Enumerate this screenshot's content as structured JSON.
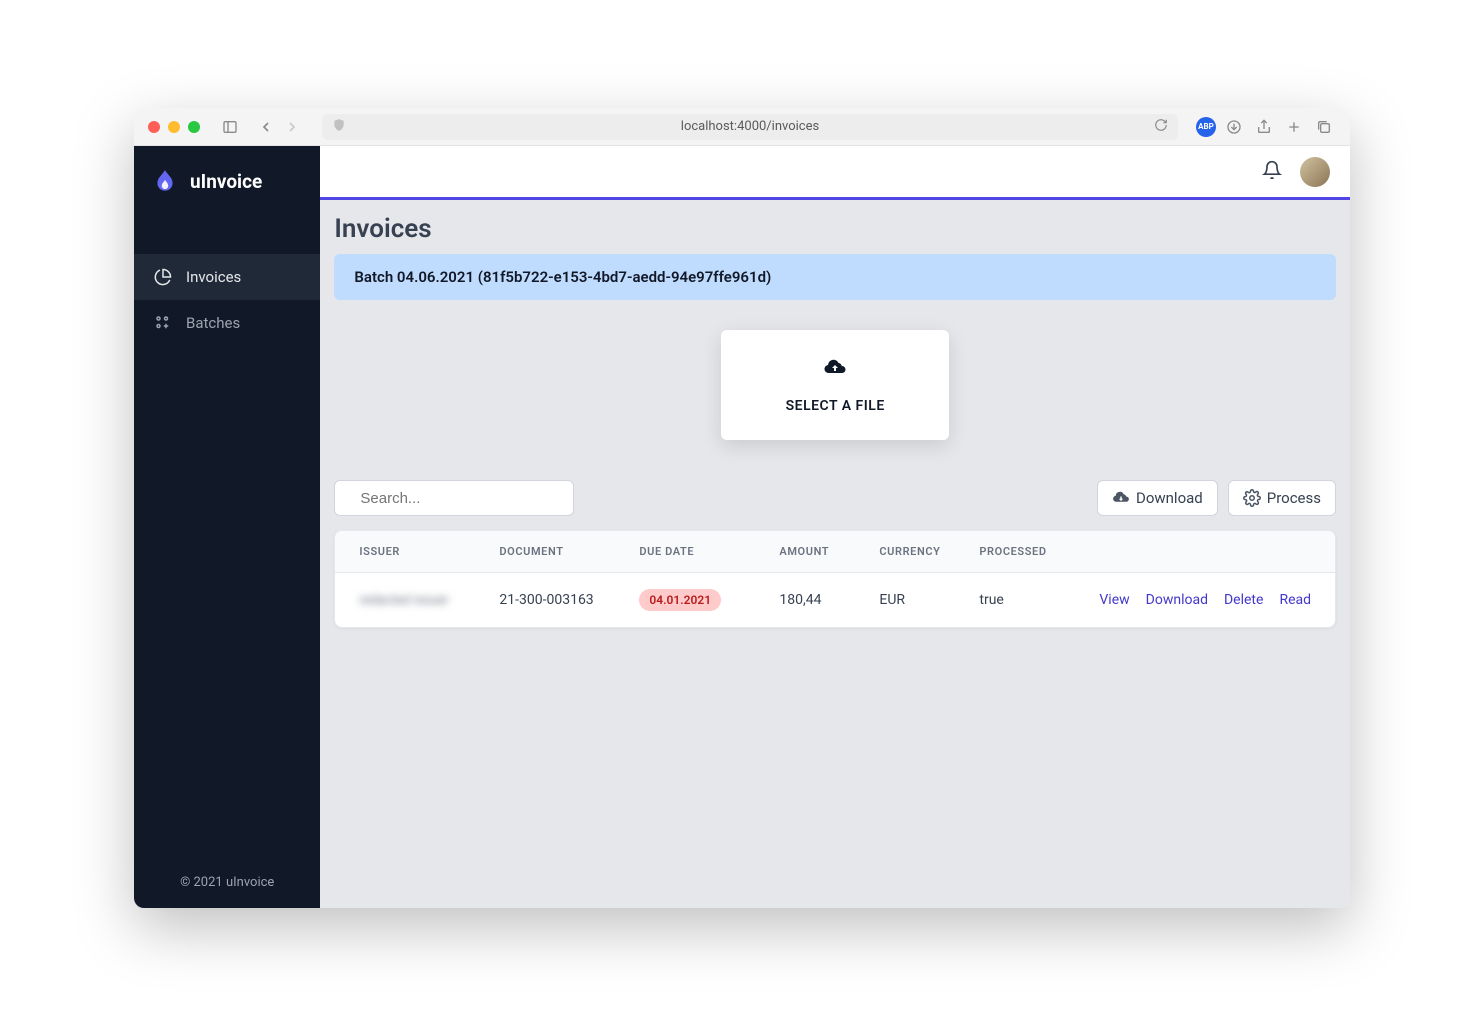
{
  "browser": {
    "url": "localhost:4000/invoices",
    "abp_label": "ABP"
  },
  "brand": {
    "name": "uInvoice"
  },
  "sidebar": {
    "items": [
      {
        "label": "Invoices",
        "active": true
      },
      {
        "label": "Batches",
        "active": false
      }
    ]
  },
  "footer": {
    "copyright": "© 2021 uInvoice"
  },
  "page": {
    "title": "Invoices",
    "batch_banner": "Batch 04.06.2021 (81f5b722-e153-4bd7-aedd-94e97ffe961d)",
    "dropzone_label": "SELECT A FILE"
  },
  "search": {
    "placeholder": "Search..."
  },
  "toolbar": {
    "download_label": "Download",
    "process_label": "Process"
  },
  "table": {
    "headers": {
      "issuer": "ISSUER",
      "document": "DOCUMENT",
      "due_date": "DUE DATE",
      "amount": "AMOUNT",
      "currency": "CURRENCY",
      "processed": "PROCESSED"
    },
    "rows": [
      {
        "issuer": "redacted issuer",
        "document": "21-300-003163",
        "due_date": "04.01.2021",
        "amount": "180,44",
        "currency": "EUR",
        "processed": "true"
      }
    ],
    "actions": {
      "view": "View",
      "download": "Download",
      "delete": "Delete",
      "read": "Read"
    }
  }
}
